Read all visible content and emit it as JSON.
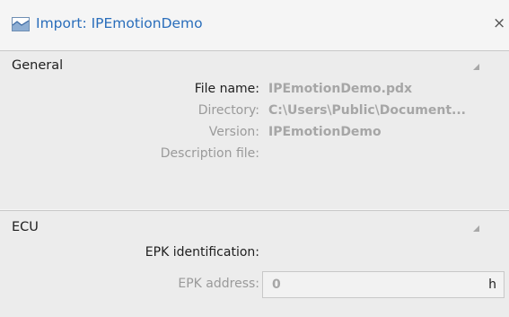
{
  "window": {
    "title": "Import: IPEmotionDemo",
    "close_glyph": "×"
  },
  "general": {
    "heading": "General",
    "fields": [
      {
        "label": "File name:",
        "value": "IPEmotionDemo.pdx"
      },
      {
        "label": "Directory:",
        "value": "C:\\Users\\Public\\Document..."
      },
      {
        "label": "Version:",
        "value": "IPEmotionDemo"
      },
      {
        "label": "Description file:",
        "value": ""
      }
    ]
  },
  "ecu": {
    "heading": "ECU",
    "epk_identification_label": "EPK identification:",
    "epk_address_label": "EPK address:",
    "epk_address_value": "0",
    "epk_address_unit": "h"
  },
  "colors": {
    "title": "#2a6ebb",
    "value_muted": "#a6a6a6"
  },
  "icons": {
    "title": "chart-area-icon",
    "collapse": "collapse-triangle-icon"
  }
}
